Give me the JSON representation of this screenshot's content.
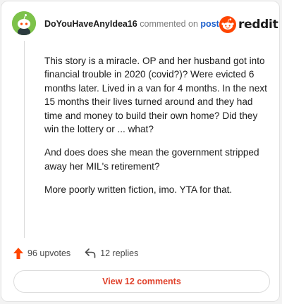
{
  "header": {
    "username": "DoYouHaveAnyIdea16",
    "action_text": "commented on",
    "post_link": "post"
  },
  "brand": {
    "wordmark": "reddit",
    "accent_color": "#ff4500"
  },
  "comment": {
    "paragraphs": [
      "This story is a miracle. OP and her husband got into financial trouble in 2020 (covid?)? Were evicted 6 months later. Lived in a van for 4 months. In the next 15 months their lives turned around and they had time and money to build their own home? Did they win the lottery or ... what?",
      "And does does she mean the government stripped away her MIL's retirement?",
      "More poorly written fiction, imo. YTA for that."
    ]
  },
  "actions": {
    "upvotes": "96 upvotes",
    "replies": "12 replies"
  },
  "footer": {
    "view_comments": "View 12 comments"
  },
  "icons": {
    "avatar": "snoo-avatar-icon",
    "logo": "reddit-logo-icon",
    "upvote": "upvote-arrow-icon",
    "reply": "reply-arrow-icon"
  }
}
